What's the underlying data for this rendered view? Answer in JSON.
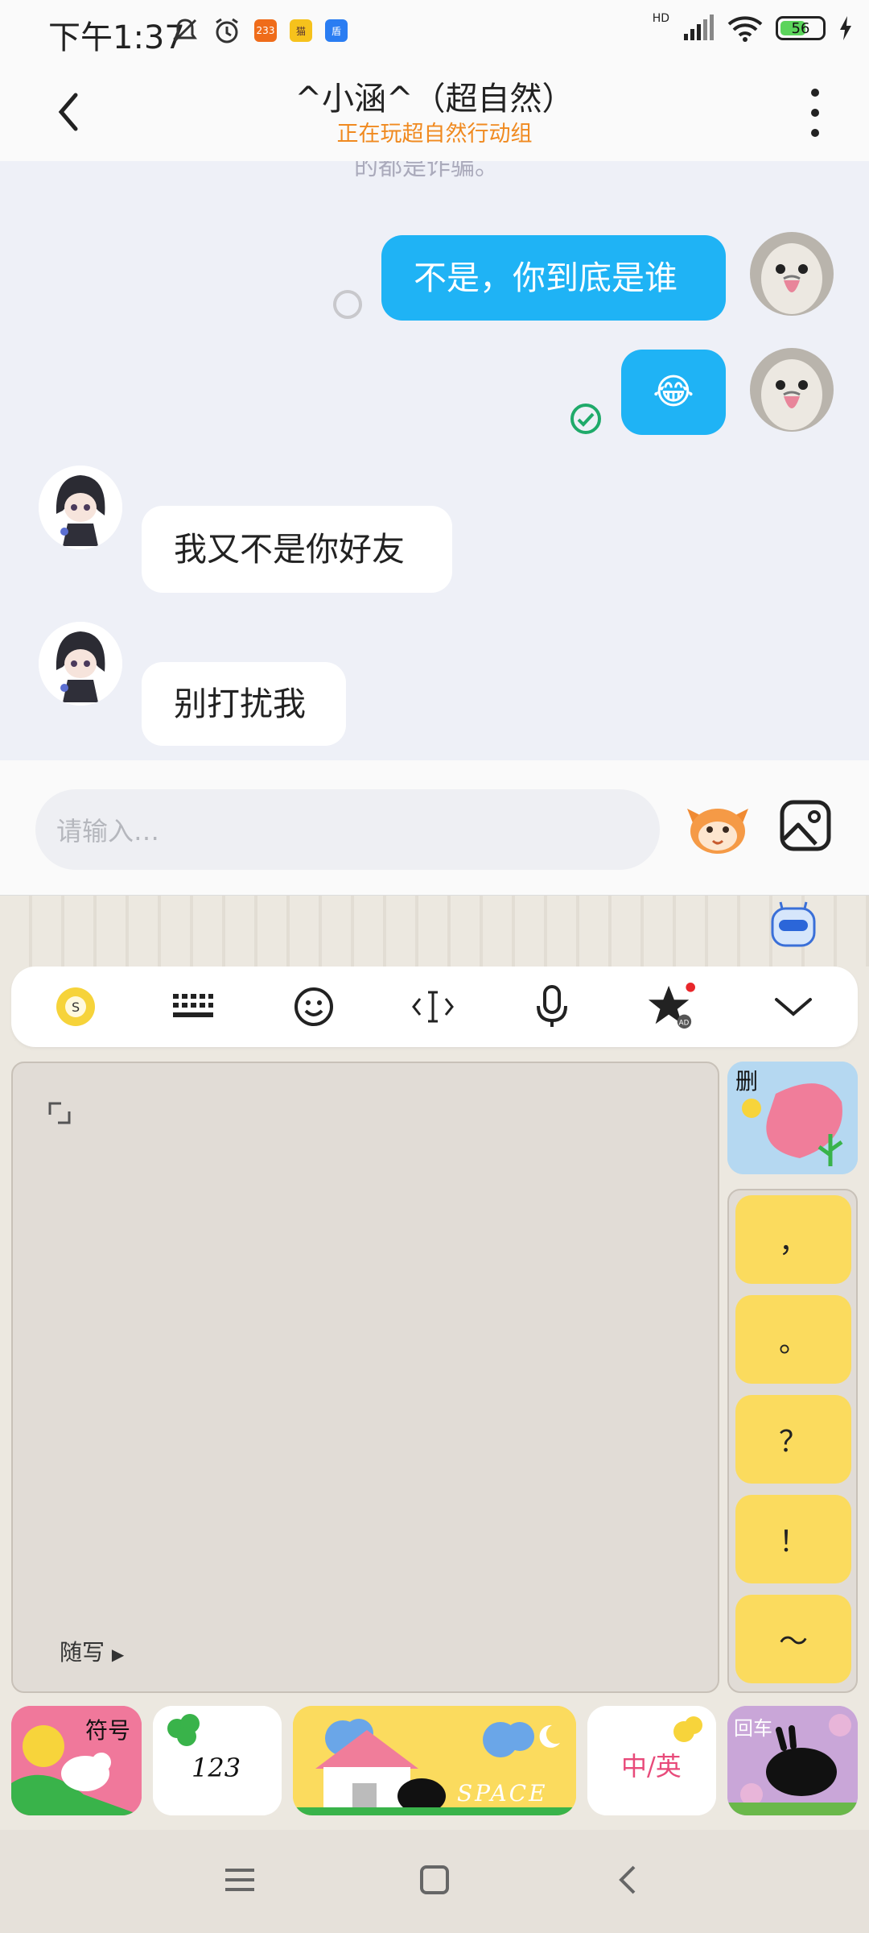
{
  "status_bar": {
    "time": "下午1:37",
    "mini_icons": [
      "233",
      "猫",
      "盾"
    ],
    "network_label": "HD",
    "battery": "56"
  },
  "header": {
    "title": "^小涵^（超自然）",
    "subtitle": "正在玩超自然行动组"
  },
  "chat": {
    "truncated_text": "的都是诈骗。",
    "messages": [
      {
        "side": "out",
        "text": "不是，你到底是谁"
      },
      {
        "side": "out",
        "text": "😂"
      },
      {
        "side": "in",
        "text": "我又不是你好友"
      },
      {
        "side": "in",
        "text": "别打扰我"
      }
    ]
  },
  "input": {
    "placeholder": "请输入…"
  },
  "keyboard": {
    "toolbar_icons": [
      "sogou-logo-icon",
      "keyboard-layout-icon",
      "emoji-icon",
      "cursor-icon",
      "microphone-icon",
      "star-ad-icon",
      "collapse-icon"
    ],
    "toolbar_ad_badge": "AD",
    "handwriting_label": "随写",
    "punctuation": [
      "，",
      "。",
      "？",
      "！",
      "～"
    ],
    "keys": {
      "delete": "删",
      "symbols": "符号",
      "numbers": "123",
      "space": "SPACE",
      "lang": "中/英",
      "enter": "回车"
    }
  },
  "colors": {
    "bubble_out": "#1fb3f5",
    "bubble_in": "#ffffff",
    "subtitle": "#f08a20",
    "punct_key": "#fbdb5e"
  }
}
